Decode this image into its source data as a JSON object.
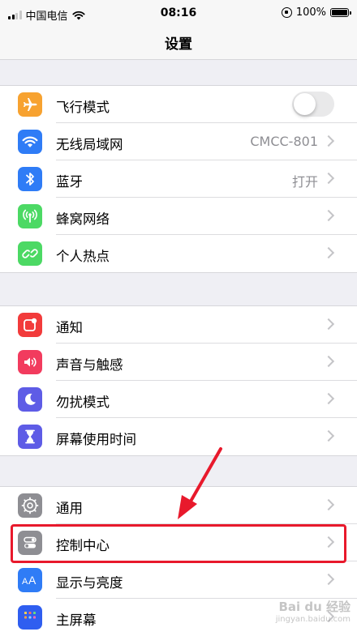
{
  "status_bar": {
    "carrier": "中国电信",
    "time": "08:16",
    "battery": "100%"
  },
  "nav": {
    "title": "设置"
  },
  "groups": [
    {
      "rows": [
        {
          "label": "飞行模式",
          "icon": "airplane-icon",
          "color": "#f7a230",
          "toggle": false
        },
        {
          "label": "无线局域网",
          "icon": "wifi-icon",
          "color": "#2f7cf6",
          "value": "CMCC-801"
        },
        {
          "label": "蓝牙",
          "icon": "bluetooth-icon",
          "color": "#2f7cf6",
          "value": "打开"
        },
        {
          "label": "蜂窝网络",
          "icon": "cellular-antenna-icon",
          "color": "#4cd964"
        },
        {
          "label": "个人热点",
          "icon": "hotspot-chain-icon",
          "color": "#4cd964"
        }
      ]
    },
    {
      "rows": [
        {
          "label": "通知",
          "icon": "notifications-icon",
          "color": "#f23b3b"
        },
        {
          "label": "声音与触感",
          "icon": "speaker-icon",
          "color": "#f23b5e"
        },
        {
          "label": "勿扰模式",
          "icon": "moon-icon",
          "color": "#5e5ce6"
        },
        {
          "label": "屏幕使用时间",
          "icon": "hourglass-icon",
          "color": "#5e5ce6"
        }
      ]
    },
    {
      "rows": [
        {
          "label": "通用",
          "icon": "gear-icon",
          "color": "#8e8e93"
        },
        {
          "label": "控制中心",
          "icon": "toggles-icon",
          "color": "#8e8e93"
        },
        {
          "label": "显示与亮度",
          "icon": "text-size-icon",
          "color": "#2f7cf6"
        },
        {
          "label": "主屏幕",
          "icon": "home-grid-icon",
          "color": "#2f5ef0"
        }
      ]
    }
  ],
  "annotation": {
    "highlight_color": "#e8192c",
    "arrow_color": "#e8192c"
  },
  "watermark": {
    "text": "Bai du 经验",
    "sub": "jingyan.baidu.com"
  }
}
